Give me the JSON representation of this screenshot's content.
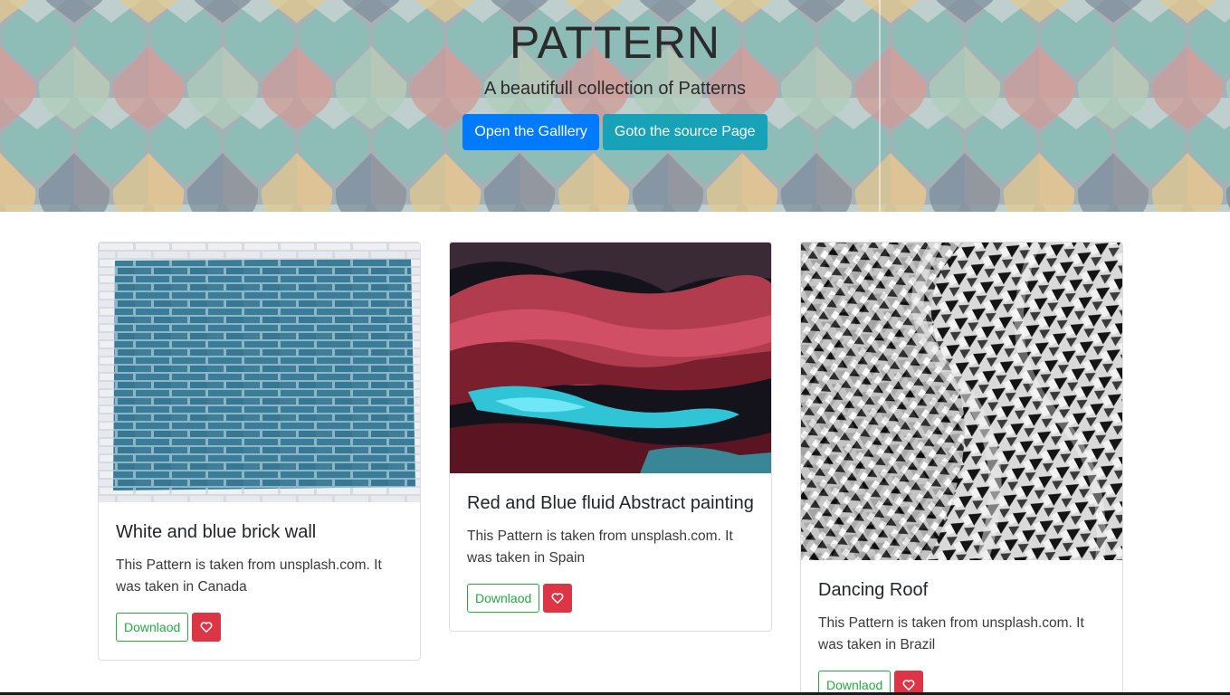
{
  "hero": {
    "title": "PATTERN",
    "subtitle": "A beautifull collection of Patterns",
    "gallery_button": "Open the Galllery",
    "source_button": "Goto the source Page"
  },
  "cards": [
    {
      "title": "White and blue brick wall",
      "text": "This Pattern is taken from unsplash.com. It was taken in Canada",
      "download_label": "Downlaod",
      "like_icon": "heart-icon"
    },
    {
      "title": "Red and Blue fluid Abstract painting",
      "text": "This Pattern is taken from unsplash.com. It was taken in Spain",
      "download_label": "Downlaod",
      "like_icon": "heart-icon"
    },
    {
      "title": "Dancing Roof",
      "text": "This Pattern is taken from unsplash.com. It was taken in Brazil",
      "download_label": "Downlaod",
      "like_icon": "heart-icon"
    }
  ],
  "colors": {
    "primary": "#007bff",
    "info": "#17a2b8",
    "success": "#28a745",
    "danger": "#dc3545"
  }
}
